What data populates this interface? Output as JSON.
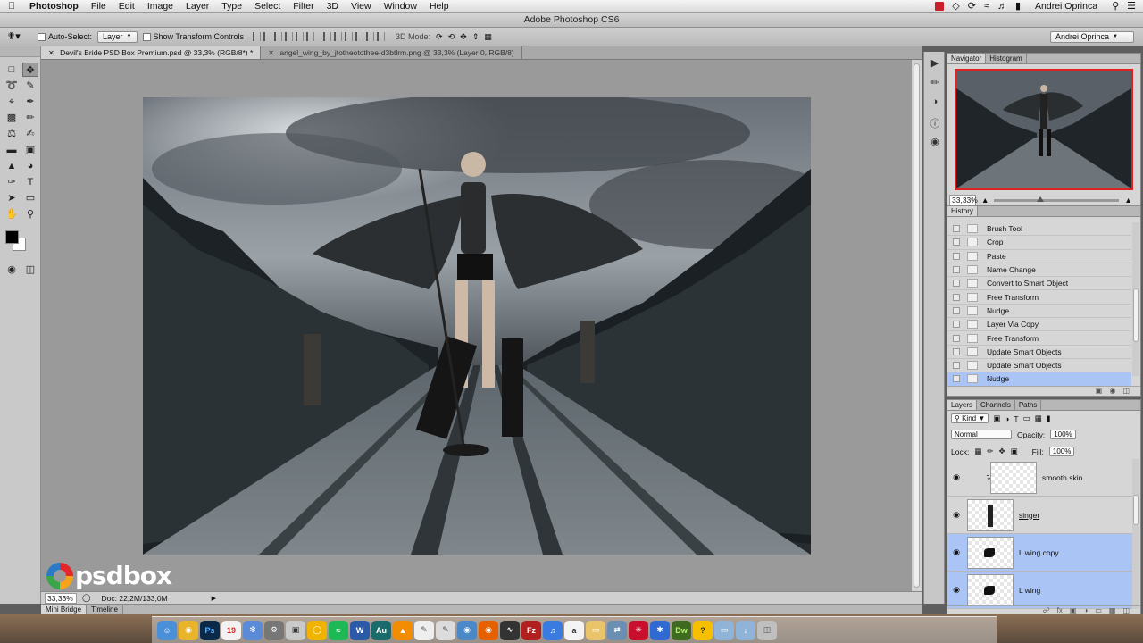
{
  "menubar": {
    "app": "Photoshop",
    "items": [
      "File",
      "Edit",
      "Image",
      "Layer",
      "Type",
      "Select",
      "Filter",
      "3D",
      "View",
      "Window",
      "Help"
    ],
    "user": "Andrei Oprinca"
  },
  "window_title": "Adobe Photoshop CS6",
  "options": {
    "auto_select_label": "Auto-Select:",
    "auto_select_value": "Layer",
    "show_transform_label": "Show Transform Controls",
    "mode_3d_label": "3D Mode:",
    "workspace_value": "Andrei Oprinca"
  },
  "tabs": [
    {
      "label": "Devil's Bride PSD Box Premium.psd @ 33,3% (RGB/8*) *",
      "active": true
    },
    {
      "label": "angel_wing_by_jtotheotothee-d3btlrm.png @ 33,3% (Layer 0, RGB/8)",
      "active": false
    }
  ],
  "status": {
    "zoom": "33,33%",
    "doc": "Doc: 22,2M/133,0M"
  },
  "bottom_tabs": [
    "Mini Bridge",
    "Timeline"
  ],
  "logo_text": "psdbox",
  "navigator": {
    "tabs": [
      "Navigator",
      "Histogram"
    ],
    "zoom": "33,33%"
  },
  "history": {
    "tabs": [
      "History"
    ],
    "items": [
      {
        "label": "Brush Tool",
        "selected": false
      },
      {
        "label": "Crop",
        "selected": false
      },
      {
        "label": "Paste",
        "selected": false
      },
      {
        "label": "Name Change",
        "selected": false
      },
      {
        "label": "Convert to Smart Object",
        "selected": false
      },
      {
        "label": "Free Transform",
        "selected": false
      },
      {
        "label": "Nudge",
        "selected": false
      },
      {
        "label": "Layer Via Copy",
        "selected": false
      },
      {
        "label": "Free Transform",
        "selected": false
      },
      {
        "label": "Update Smart Objects",
        "selected": false
      },
      {
        "label": "Update Smart Objects",
        "selected": false
      },
      {
        "label": "Nudge",
        "selected": true
      }
    ]
  },
  "layers": {
    "tabs": [
      "Layers",
      "Channels",
      "Paths"
    ],
    "kind": "Kind",
    "blend": "Normal",
    "opacity_label": "Opacity:",
    "opacity": "100%",
    "lock_label": "Lock:",
    "fill_label": "Fill:",
    "fill": "100%",
    "items": [
      {
        "name": "smooth skin",
        "selected": false
      },
      {
        "name": "singer",
        "selected": false
      },
      {
        "name": "L wing copy",
        "selected": true
      },
      {
        "name": "L wing",
        "selected": true
      }
    ]
  },
  "dock_apps": [
    "Finder",
    "Chrome",
    "Ps",
    "Calendar",
    "Safari",
    "Utility",
    "Preview",
    "Spotify",
    "Word",
    "Au",
    "VLC",
    "TextEdit",
    "Scripts",
    "Network",
    "Firefox",
    "Activity",
    "FileZilla",
    "iTunes",
    "Script",
    "Folder",
    "Migration",
    "Acrobat",
    "Bluetooth",
    "Dw",
    "Help",
    "Docs",
    "Downloads",
    "Trash"
  ],
  "colors": {
    "accent_selection": "#a9c4f5",
    "history_highlight": "#a9c4f5",
    "navigator_frame": "#dd2222"
  }
}
